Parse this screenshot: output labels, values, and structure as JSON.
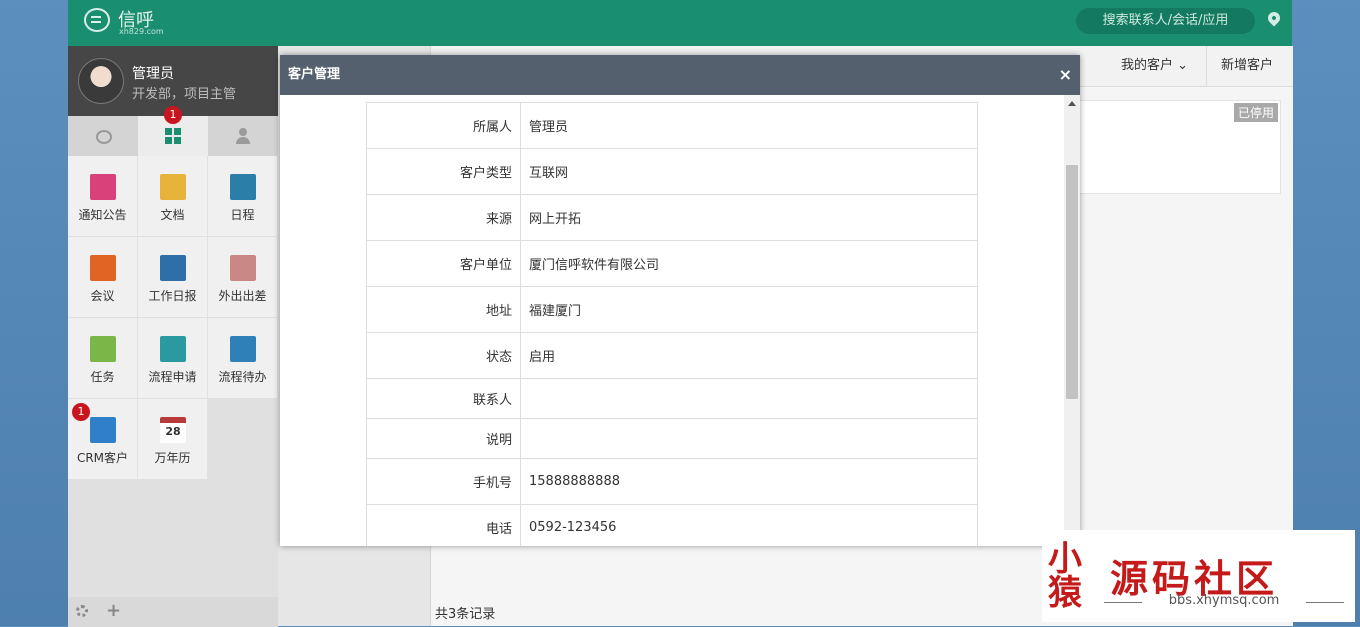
{
  "app": {
    "logo_text": "信呼",
    "logo_sub": "xh829.com",
    "search_placeholder": "搜索联系人/会话/应用"
  },
  "user": {
    "name": "管理员",
    "dept": "开发部，项目主管"
  },
  "tabs": [
    {
      "icon": "chat-icon"
    },
    {
      "icon": "apps-grid-icon",
      "badge": "1"
    },
    {
      "icon": "person-icon"
    }
  ],
  "apps": [
    {
      "label": "通知公告",
      "icon": "announcement-icon",
      "color": "#d9417a"
    },
    {
      "label": "文档",
      "icon": "folder-icon",
      "color": "#e8b33b"
    },
    {
      "label": "日程",
      "icon": "schedule-icon",
      "color": "#2a7ea8"
    },
    {
      "label": "会议",
      "icon": "meeting-icon",
      "color": "#e06524"
    },
    {
      "label": "工作日报",
      "icon": "report-icon",
      "color": "#2f6fa8"
    },
    {
      "label": "外出出差",
      "icon": "travel-icon",
      "color": "#c98884"
    },
    {
      "label": "任务",
      "icon": "task-icon",
      "color": "#7ab648"
    },
    {
      "label": "流程申请",
      "icon": "flow-apply-icon",
      "color": "#2a9aa0"
    },
    {
      "label": "流程待办",
      "icon": "flow-todo-icon",
      "color": "#2f80b8"
    },
    {
      "label": "CRM客户",
      "icon": "crm-icon",
      "color": "#2f80c8",
      "badge": "1"
    },
    {
      "label": "万年历",
      "icon": "calendar-icon",
      "color": "#b73a3a",
      "calendar_day": "28"
    }
  ],
  "right": {
    "my_customers": "我的客户",
    "add_customer": "新增客户",
    "disabled_tag": "已停用",
    "total": "共3条记录"
  },
  "modal": {
    "title": "客户管理",
    "close": "×",
    "rows": [
      {
        "label": "所属人",
        "value": "管理员"
      },
      {
        "label": "客户类型",
        "value": "互联网"
      },
      {
        "label": "来源",
        "value": "网上开拓"
      },
      {
        "label": "客户单位",
        "value": "厦门信呼软件有限公司"
      },
      {
        "label": "地址",
        "value": "福建厦门"
      },
      {
        "label": "状态",
        "value": "启用"
      },
      {
        "label": "联系人",
        "value": ""
      },
      {
        "label": "说明",
        "value": ""
      },
      {
        "label": "手机号",
        "value": "15888888888"
      },
      {
        "label": "电话",
        "value": "0592-123456"
      }
    ]
  },
  "watermark": {
    "seal": "小猿",
    "title": "源码社区",
    "url": "bbs.xhymsq.com"
  }
}
